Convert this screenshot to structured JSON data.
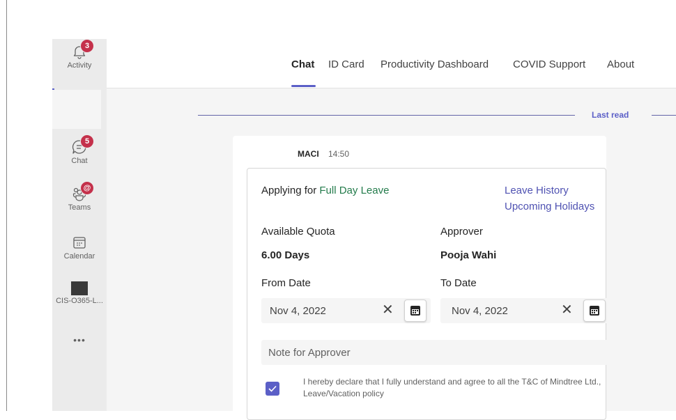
{
  "rail": {
    "activity": {
      "label": "Activity",
      "badge": "3",
      "icon": "bell-icon"
    },
    "chat": {
      "label": "Chat",
      "badge": "5",
      "icon": "chat-icon"
    },
    "teams": {
      "label": "Teams",
      "badge": "@",
      "icon": "teams-icon"
    },
    "calendar": {
      "label": "Calendar",
      "icon": "calendar-icon"
    },
    "app": {
      "label": "CIS-O365-L..."
    },
    "more": {
      "label": "•••",
      "icon": "more-icon"
    }
  },
  "tabs": [
    {
      "label": "Chat",
      "active": true
    },
    {
      "label": "ID Card"
    },
    {
      "label": "Productivity Dashboard"
    },
    {
      "label": "COVID Support"
    },
    {
      "label": "About"
    }
  ],
  "divider": {
    "label": "Last read"
  },
  "message": {
    "author": "MACI",
    "time": "14:50",
    "card": {
      "applying_prefix": "Applying for",
      "leave_type": "Full Day Leave",
      "links": {
        "history": "Leave History",
        "holidays": "Upcoming Holidays"
      },
      "quota_label": "Available Quota",
      "quota_value": "6.00 Days",
      "approver_label": "Approver",
      "approver_value": "Pooja Wahi",
      "from_label": "From Date",
      "from_value": "Nov 4, 2022",
      "to_label": "To Date",
      "to_value": "Nov 4, 2022",
      "clear_glyph": "✕",
      "note_placeholder": "Note for Approver",
      "declaration": "I hereby declare that I fully understand and agree to all the T&C of Mindtree Ltd., Leave/Vacation policy",
      "declaration_checked": true
    }
  },
  "colors": {
    "accent": "#5b5fc7",
    "badge": "#c4314b",
    "leave_green": "#237b4b",
    "link": "#4f52b2"
  }
}
